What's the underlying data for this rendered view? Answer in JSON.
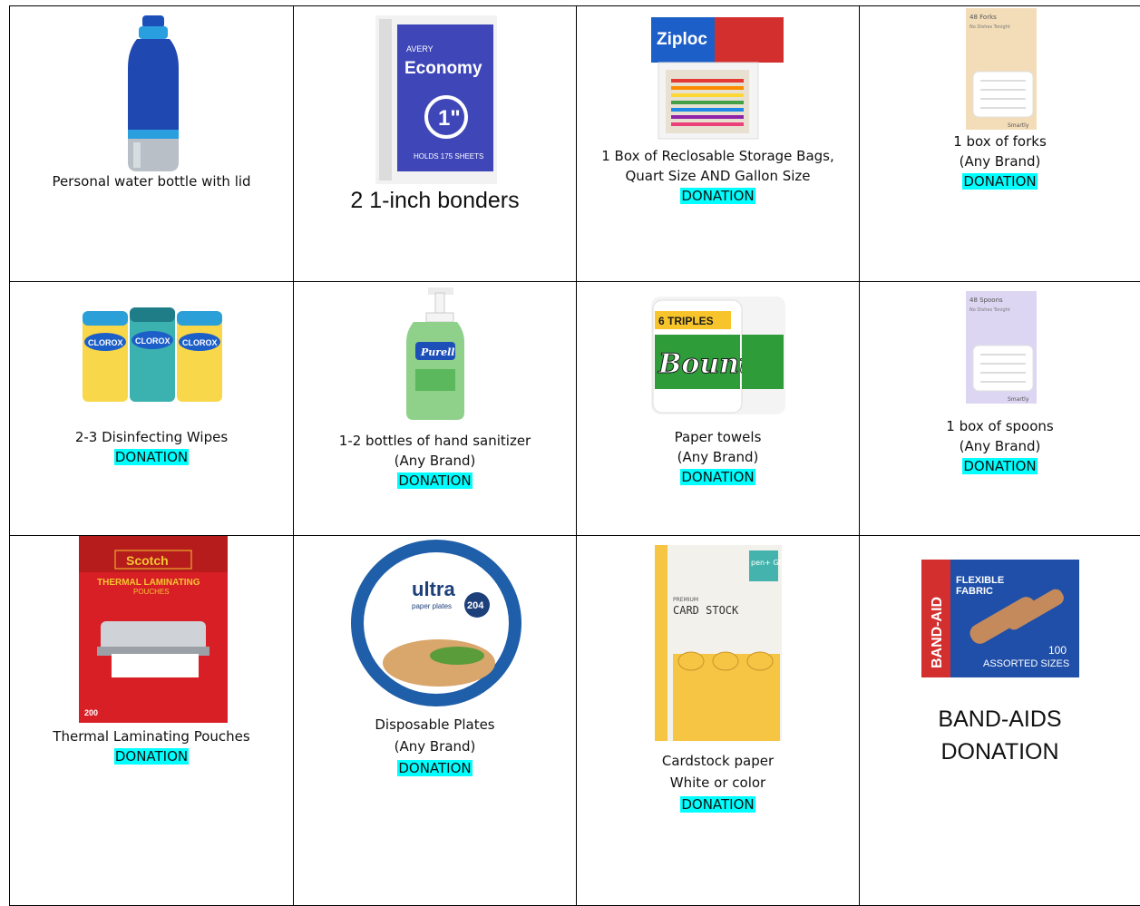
{
  "items": [
    {
      "lines": [
        "Personal water bottle with lid"
      ],
      "donation": ""
    },
    {
      "lines": [
        "2 1-inch bonders"
      ],
      "donation": ""
    },
    {
      "lines": [
        "1 Box of Reclosable Storage Bags,",
        "Quart Size AND Gallon Size"
      ],
      "donation": "DONATION"
    },
    {
      "lines": [
        "1 box of forks",
        "(Any Brand)"
      ],
      "donation": "DONATION"
    },
    {
      "lines": [
        "2-3 Disinfecting Wipes"
      ],
      "donation": "DONATION"
    },
    {
      "lines": [
        "1-2 bottles of hand sanitizer",
        "(Any Brand)"
      ],
      "donation": "DONATION"
    },
    {
      "lines": [
        "Paper towels",
        "(Any Brand)"
      ],
      "donation": "DONATION"
    },
    {
      "lines": [
        "1 box of spoons",
        "(Any Brand)"
      ],
      "donation": "DONATION"
    },
    {
      "lines": [
        "Thermal Laminating Pouches"
      ],
      "donation": "DONATION"
    },
    {
      "lines": [
        "Disposable Plates",
        "(Any Brand)"
      ],
      "donation": "DONATION"
    },
    {
      "lines": [
        "Cardstock paper",
        "White or color"
      ],
      "donation": "DONATION"
    },
    {
      "lines": [
        "BAND-AIDS",
        "DONATION"
      ],
      "donation": ""
    }
  ],
  "product_text": {
    "binder_brand": "AVERY",
    "binder_name": "Economy",
    "binder_size": "1\"",
    "binder_holds": "HOLDS 175 SHEETS",
    "ziploc_brand": "Ziploc",
    "fork_label": "48 Forks",
    "fork_sub": "No Dishes Tonight",
    "spoon_label": "48 Spoons",
    "spoon_sub": "No Dishes Tonight",
    "smartly": "Smartly",
    "clorox": "CLOROX",
    "purell": "Purell",
    "bounty": "Bounty",
    "triples": "6 TRIPLES",
    "scotch": "Scotch",
    "thermal": "THERMAL LAMINATING",
    "pouches": "POUCHES",
    "pouch_count": "200",
    "ultra": "ultra",
    "paper_plates": "paper plates",
    "plate_count": "204",
    "pengear": "pen+ GEAR",
    "premium": "PREMIUM",
    "card_stock": "CARD STOCK",
    "bandaid_brand": "BAND-AID",
    "flexible": "FLEXIBLE",
    "fabric": "FABRIC",
    "bandaid_count": "100",
    "assorted": "ASSORTED SIZES"
  },
  "colors": {
    "donation_highlight": "#00ffff",
    "border": "#000000"
  }
}
